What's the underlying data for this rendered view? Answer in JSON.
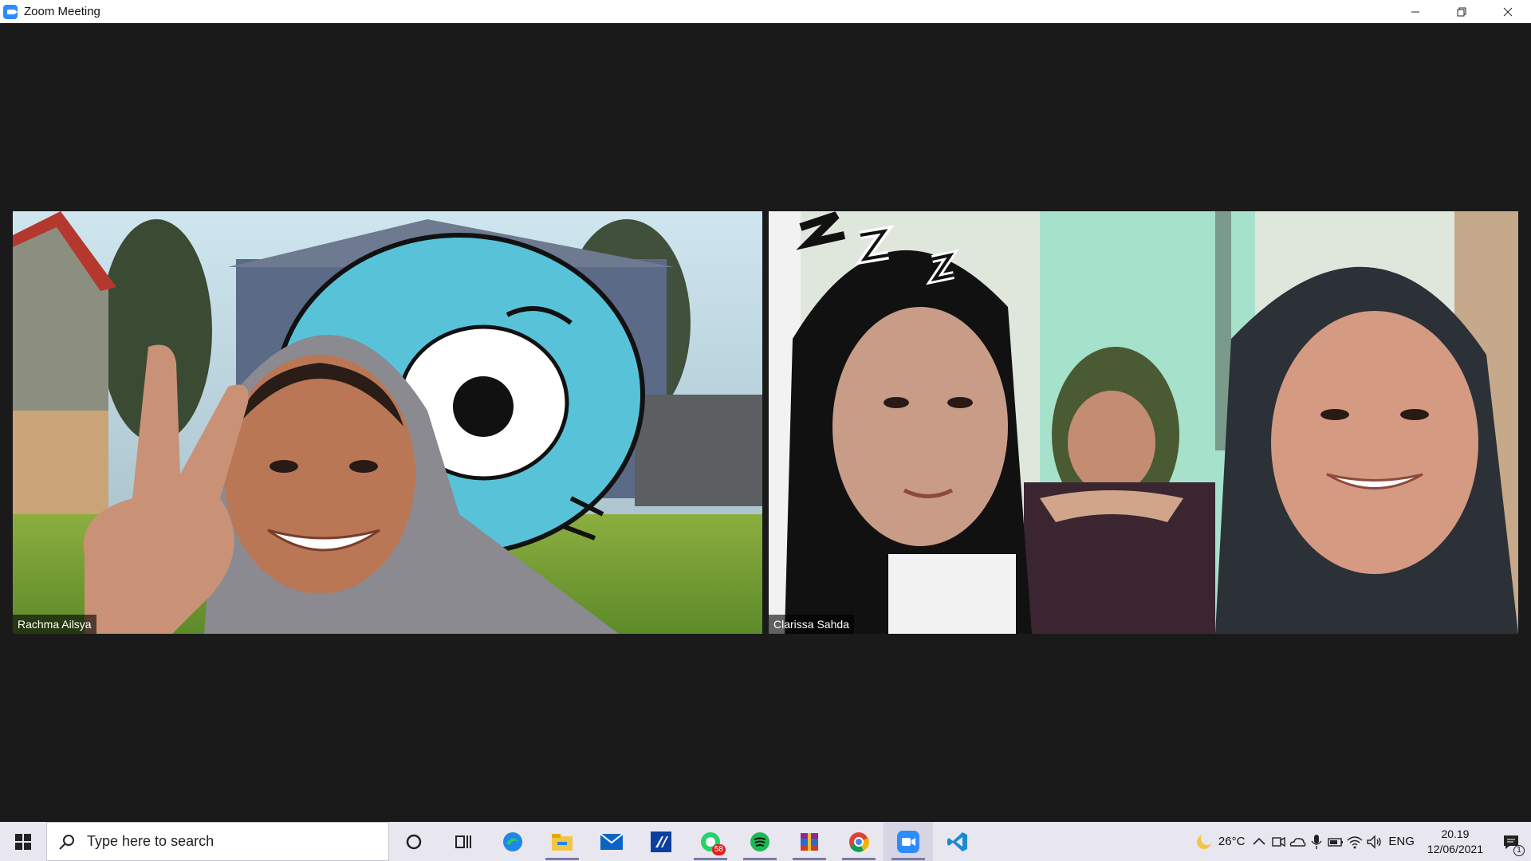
{
  "window": {
    "title": "Zoom Meeting"
  },
  "participants": [
    {
      "name": "Rachma Ailsya"
    },
    {
      "name": "Clarissa Sahda"
    }
  ],
  "taskbar": {
    "search_placeholder": "Type here to search",
    "apps": [
      {
        "icon": "cortana-icon"
      },
      {
        "icon": "task-view-icon"
      },
      {
        "icon": "edge-icon"
      },
      {
        "icon": "file-explorer-icon"
      },
      {
        "icon": "mail-icon"
      },
      {
        "icon": "app-icon"
      },
      {
        "icon": "whatsapp-icon",
        "badge": "58"
      },
      {
        "icon": "spotify-icon"
      },
      {
        "icon": "winrar-icon"
      },
      {
        "icon": "chrome-icon"
      },
      {
        "icon": "zoom-icon"
      },
      {
        "icon": "vscode-icon"
      }
    ],
    "weather": "26°C",
    "language": "ENG",
    "time": "20.19",
    "date": "12/06/2021",
    "notifications": "1"
  }
}
